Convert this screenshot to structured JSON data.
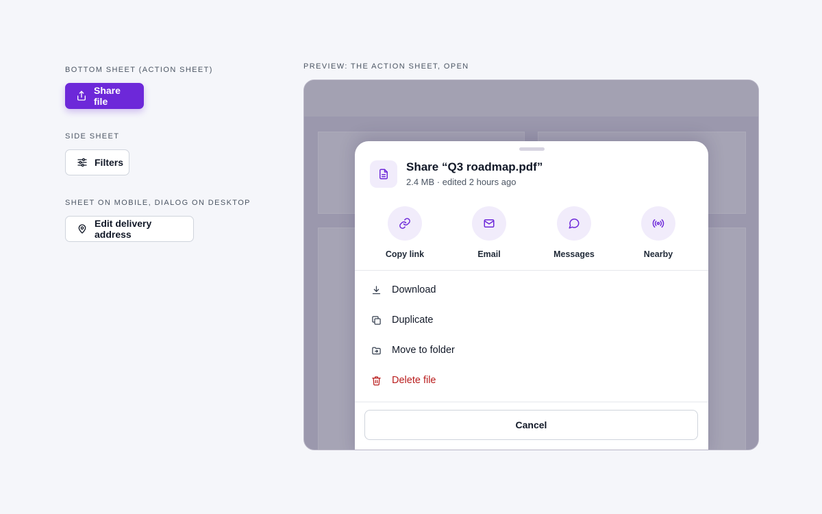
{
  "controls": {
    "bottom_sheet": {
      "section_label": "BOTTOM SHEET (ACTION SHEET)",
      "button_label": "Share file",
      "icon": "share-icon"
    },
    "side_sheet": {
      "section_label": "SIDE SHEET",
      "button_label": "Filters",
      "icon": "sliders-icon"
    },
    "responsive": {
      "section_label": "SHEET ON MOBILE, DIALOG ON DESKTOP",
      "button_label": "Edit delivery address",
      "icon": "map-pin-icon"
    }
  },
  "preview": {
    "label": "PREVIEW: THE ACTION SHEET, OPEN",
    "sheet": {
      "title": "Share “Q3 roadmap.pdf”",
      "subtitle": "2.4 MB · edited 2 hours ago",
      "file_icon": "document-icon",
      "share_targets": [
        {
          "label": "Copy link",
          "icon": "link-icon"
        },
        {
          "label": "Email",
          "icon": "mail-icon"
        },
        {
          "label": "Messages",
          "icon": "chat-bubble-icon"
        },
        {
          "label": "Nearby",
          "icon": "broadcast-icon"
        }
      ],
      "actions": [
        {
          "label": "Download",
          "icon": "download-icon"
        },
        {
          "label": "Duplicate",
          "icon": "copy-icon"
        },
        {
          "label": "Move to folder",
          "icon": "folder-move-icon"
        },
        {
          "label": "Delete file",
          "icon": "trash-icon",
          "danger": true
        }
      ],
      "cancel_label": "Cancel"
    }
  },
  "colors": {
    "accent": "#6d28d9",
    "accent_soft": "#f1ecfb",
    "danger": "#b91c1c",
    "page_bg": "#f5f6fa",
    "overlay": "#9b98ad"
  }
}
